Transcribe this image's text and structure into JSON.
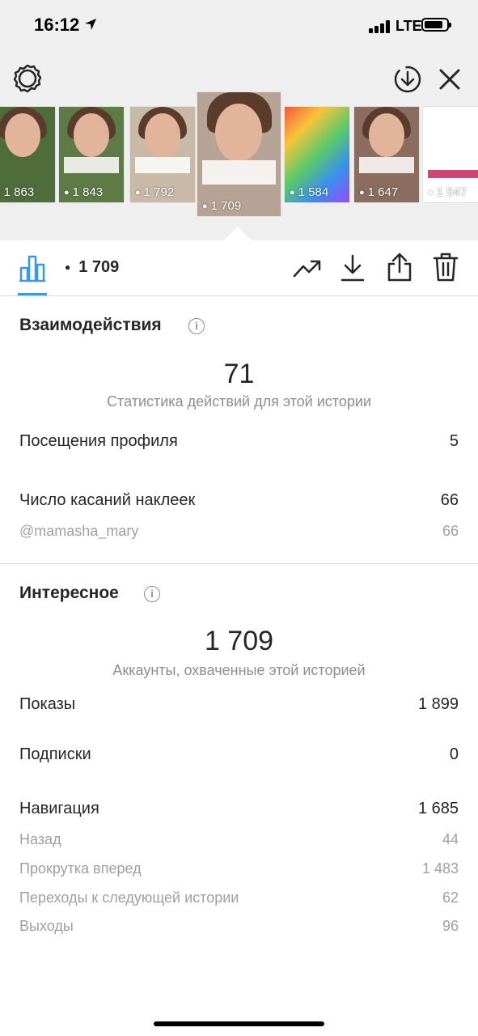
{
  "status_bar": {
    "time": "16:12",
    "network": "LTE"
  },
  "stories": [
    {
      "views": "1 863"
    },
    {
      "views": "1 843"
    },
    {
      "views": "1 792"
    },
    {
      "views": "1 709"
    },
    {
      "views": "1 584"
    },
    {
      "views": "1 647"
    },
    {
      "views": "1 547"
    }
  ],
  "toolbar": {
    "views": "1 709"
  },
  "interactions": {
    "title": "Взаимодействия",
    "total": "71",
    "caption": "Статистика действий для этой истории",
    "profile_visits_label": "Посещения профиля",
    "profile_visits_value": "5",
    "sticker_taps_label": "Число касаний наклеек",
    "sticker_taps_value": "66",
    "mention_label": "@mamasha_mary",
    "mention_value": "66"
  },
  "discovery": {
    "title": "Интересное",
    "reach": "1 709",
    "caption": "Аккаунты, охваченные этой историей",
    "impressions_label": "Показы",
    "impressions_value": "1 899",
    "follows_label": "Подписки",
    "follows_value": "0",
    "navigation_label": "Навигация",
    "navigation_value": "1 685",
    "back_label": "Назад",
    "back_value": "44",
    "forward_label": "Прокрутка вперед",
    "forward_value": "1 483",
    "next_story_label": "Переходы к следующей истории",
    "next_story_value": "62",
    "exits_label": "Выходы",
    "exits_value": "96"
  },
  "colors": {
    "accent": "#3897f0",
    "text": "#262626",
    "muted": "#8e8e8e",
    "bar_bg": "#efefef"
  }
}
